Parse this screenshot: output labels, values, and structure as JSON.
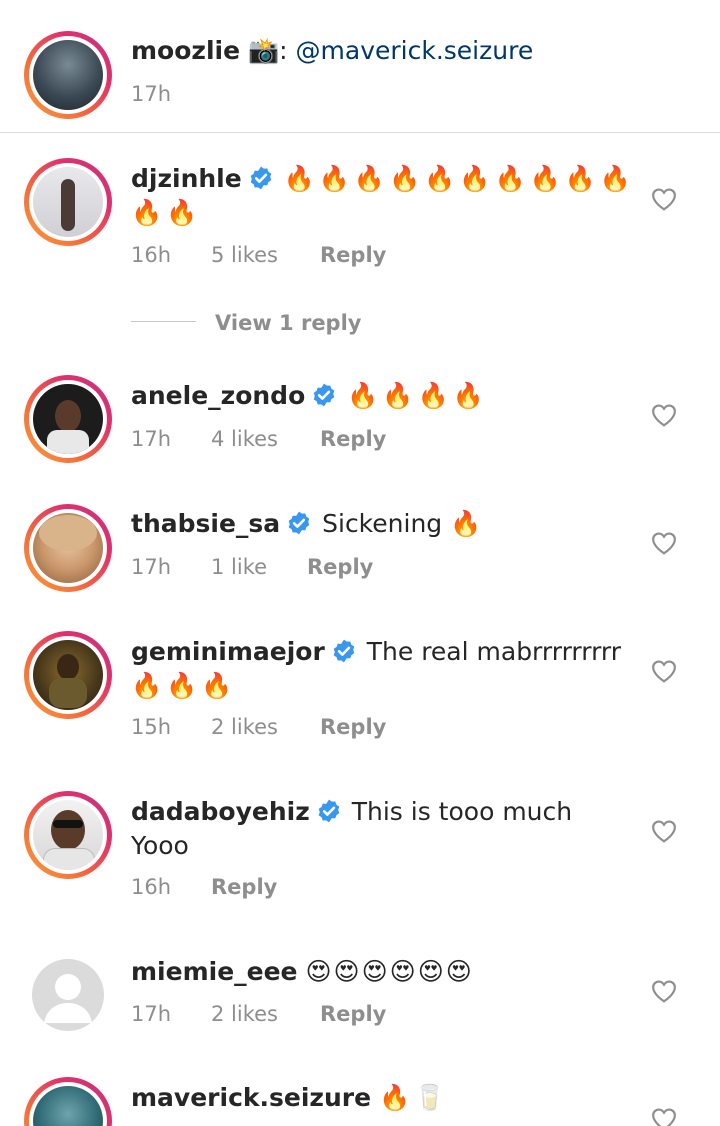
{
  "caption": {
    "username": "moozlie",
    "camera_emoji": "📸",
    "separator": ":",
    "mention": "@maverick.seizure",
    "time": "17h"
  },
  "comments": [
    {
      "username": "djzinhle",
      "verified": true,
      "line1": "🔥🔥🔥🔥🔥🔥🔥🔥🔥🔥",
      "line2": "🔥🔥",
      "time": "16h",
      "likes": "5 likes",
      "reply": "Reply"
    },
    {
      "username": "anele_zondo",
      "verified": true,
      "line1": "🔥🔥🔥🔥",
      "time": "17h",
      "likes": "4 likes",
      "reply": "Reply"
    },
    {
      "username": "thabsie_sa",
      "verified": true,
      "line1": "Sickening 🔥",
      "time": "17h",
      "likes": "1 like",
      "reply": "Reply"
    },
    {
      "username": "geminimaejor",
      "verified": true,
      "line1": "The real mabrrrrrrrrr",
      "line2": "🔥🔥🔥",
      "time": "15h",
      "likes": "2 likes",
      "reply": "Reply"
    },
    {
      "username": "dadaboyehiz",
      "verified": true,
      "line1": "This is tooo much",
      "line2": "Yooo",
      "time": "16h",
      "reply": "Reply"
    },
    {
      "username": "miemie_eee",
      "verified": false,
      "line1": "😍😍😍😍😍😍",
      "time": "17h",
      "likes": "2 likes",
      "reply": "Reply"
    },
    {
      "username": "maverick.seizure",
      "verified": false,
      "line1": "🔥🥛"
    }
  ],
  "view_replies": "View 1 reply",
  "colors": {
    "text": "#262626",
    "meta": "#8e8e8e",
    "verified": "#3897f0",
    "mention": "#00376b",
    "divider": "#dbdbdb"
  },
  "icons": [
    "verified-badge-icon",
    "heart-outline-icon",
    "default-avatar-icon"
  ]
}
